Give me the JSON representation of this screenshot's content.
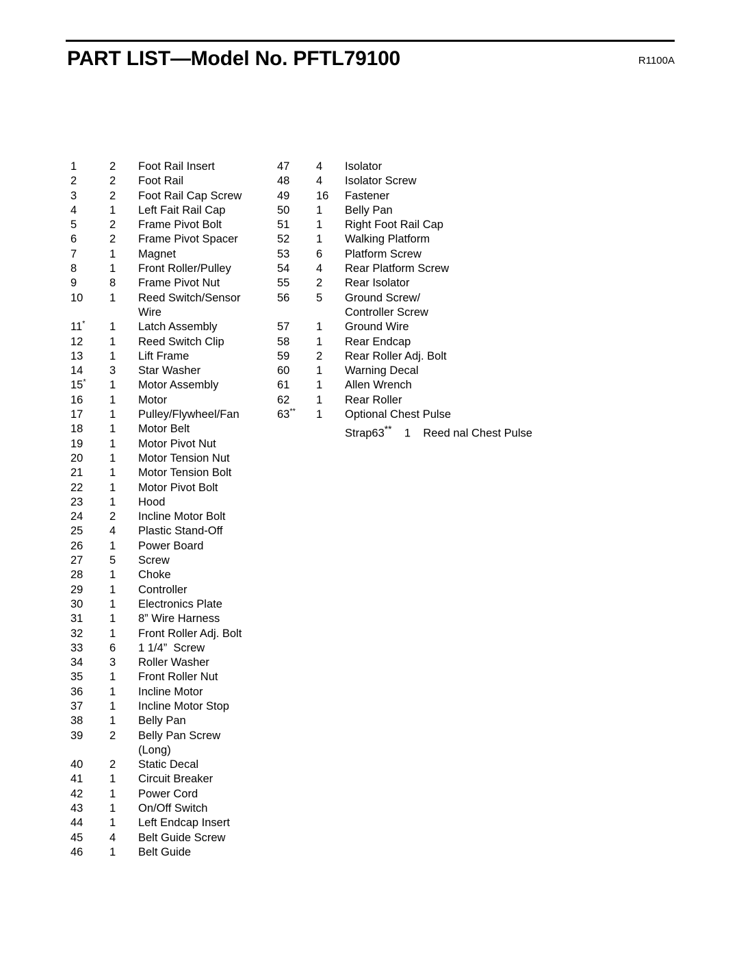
{
  "document": {
    "title": "PART LIST—Model No. PFTL79100",
    "revision_code": "R1100A"
  },
  "parts": {
    "left_column": [
      {
        "num": "1",
        "qty": "2",
        "desc": "Foot Rail Insert"
      },
      {
        "num": "2",
        "qty": "2",
        "desc": "Foot Rail"
      },
      {
        "num": "3",
        "qty": "2",
        "desc": "Foot Rail Cap Screw"
      },
      {
        "num": "4",
        "qty": "1",
        "desc": "Left Fait Rail Cap"
      },
      {
        "num": "5",
        "qty": "2",
        "desc": "Frame Pivot Bolt"
      },
      {
        "num": "6",
        "qty": "2",
        "desc": "Frame Pivot Spacer"
      },
      {
        "num": "7",
        "qty": "1",
        "desc": "Magnet"
      },
      {
        "num": "8",
        "qty": "1",
        "desc": "Front Roller/Pulley"
      },
      {
        "num": "9",
        "qty": "8",
        "desc": "Frame Pivot Nut"
      },
      {
        "num": "10",
        "qty": "1",
        "desc": "Reed Switch/Sensor"
      },
      {
        "num": "",
        "qty": "",
        "desc": "Wire",
        "continuation": true
      },
      {
        "num": "11*",
        "qty": "1",
        "desc": "Latch Assembly"
      },
      {
        "num": "12",
        "qty": "1",
        "desc": "Reed Switch Clip"
      },
      {
        "num": "13",
        "qty": "1",
        "desc": "Lift Frame"
      },
      {
        "num": "14",
        "qty": "3",
        "desc": "Star Washer"
      },
      {
        "num": "15*",
        "qty": "1",
        "desc": "Motor Assembly"
      },
      {
        "num": "16",
        "qty": "1",
        "desc": "Motor"
      },
      {
        "num": "17",
        "qty": "1",
        "desc": "Pulley/Flywheel/Fan"
      },
      {
        "num": "18",
        "qty": "1",
        "desc": "Motor Belt"
      },
      {
        "num": "19",
        "qty": "1",
        "desc": "Motor Pivot Nut"
      },
      {
        "num": "20",
        "qty": "1",
        "desc": "Motor Tension Nut"
      },
      {
        "num": "21",
        "qty": "1",
        "desc": "Motor Tension Bolt"
      },
      {
        "num": "22",
        "qty": "1",
        "desc": "Motor Pivot Bolt"
      },
      {
        "num": "23",
        "qty": "1",
        "desc": "Hood"
      },
      {
        "num": "24",
        "qty": "2",
        "desc": "Incline Motor Bolt"
      },
      {
        "num": "25",
        "qty": "4",
        "desc": "Plastic Stand-Off"
      },
      {
        "num": "26",
        "qty": "1",
        "desc": "Power Board"
      },
      {
        "num": "27",
        "qty": "5",
        "desc": "Screw"
      },
      {
        "num": "28",
        "qty": "1",
        "desc": "Choke"
      },
      {
        "num": "29",
        "qty": "1",
        "desc": "Controller"
      },
      {
        "num": "30",
        "qty": "1",
        "desc": "Electronics Plate"
      },
      {
        "num": "31",
        "qty": "1",
        "desc": "8” Wire Harness"
      },
      {
        "num": "32",
        "qty": "1",
        "desc": "Front Roller Adj. Bolt"
      },
      {
        "num": "33",
        "qty": "6",
        "desc": "1 1/4”  Screw"
      },
      {
        "num": "34",
        "qty": "3",
        "desc": "Roller Washer"
      },
      {
        "num": "35",
        "qty": "1",
        "desc": "Front Roller Nut"
      },
      {
        "num": "36",
        "qty": "1",
        "desc": "Incline Motor"
      },
      {
        "num": "37",
        "qty": "1",
        "desc": "Incline Motor Stop"
      },
      {
        "num": "38",
        "qty": "1",
        "desc": "Belly Pan"
      },
      {
        "num": "39",
        "qty": "2",
        "desc": "Belly Pan Screw"
      },
      {
        "num": "",
        "qty": "",
        "desc": "(Long)",
        "continuation": true
      },
      {
        "num": "40",
        "qty": "2",
        "desc": "Static Decal"
      },
      {
        "num": "41",
        "qty": "1",
        "desc": "Circuit Breaker"
      },
      {
        "num": "42",
        "qty": "1",
        "desc": "Power Cord"
      },
      {
        "num": "43",
        "qty": "1",
        "desc": "On/Off Switch"
      },
      {
        "num": "44",
        "qty": "1",
        "desc": "Left Endcap Insert"
      },
      {
        "num": "45",
        "qty": "4",
        "desc": "Belt Guide Screw"
      },
      {
        "num": "46",
        "qty": "1",
        "desc": "Belt Guide"
      }
    ],
    "right_column": [
      {
        "num": "47",
        "qty": "4",
        "desc": "Isolator"
      },
      {
        "num": "48",
        "qty": "4",
        "desc": "Isolator Screw"
      },
      {
        "num": "49",
        "qty": "16",
        "desc": "Fastener"
      },
      {
        "num": "50",
        "qty": "1",
        "desc": "Belly Pan"
      },
      {
        "num": "51",
        "qty": "1",
        "desc": "Right Foot Rail Cap"
      },
      {
        "num": "52",
        "qty": "1",
        "desc": "Walking Platform"
      },
      {
        "num": "53",
        "qty": "6",
        "desc": "Platform Screw"
      },
      {
        "num": "54",
        "qty": "4",
        "desc": "Rear Platform Screw"
      },
      {
        "num": "55",
        "qty": "2",
        "desc": "Rear Isolator"
      },
      {
        "num": "56",
        "qty": "5",
        "desc": "Ground Screw/"
      },
      {
        "num": "",
        "qty": "",
        "desc": "Controller Screw",
        "continuation": true
      },
      {
        "num": "57",
        "qty": "1",
        "desc": "Ground Wire"
      },
      {
        "num": "58",
        "qty": "1",
        "desc": "Rear Endcap"
      },
      {
        "num": "59",
        "qty": "2",
        "desc": "Rear Roller Adj. Bolt"
      },
      {
        "num": "60",
        "qty": "1",
        "desc": "Warning Decal"
      },
      {
        "num": "61",
        "qty": "1",
        "desc": "Allen Wrench"
      },
      {
        "num": "62",
        "qty": "1",
        "desc": "Rear Roller"
      },
      {
        "num": "63**",
        "qty": "1",
        "desc": "Optional Chest Pulse"
      },
      {
        "num": "",
        "qty": "",
        "desc": "Strap63**    1    Reed nal Chest Pulse",
        "continuation": true
      }
    ]
  }
}
